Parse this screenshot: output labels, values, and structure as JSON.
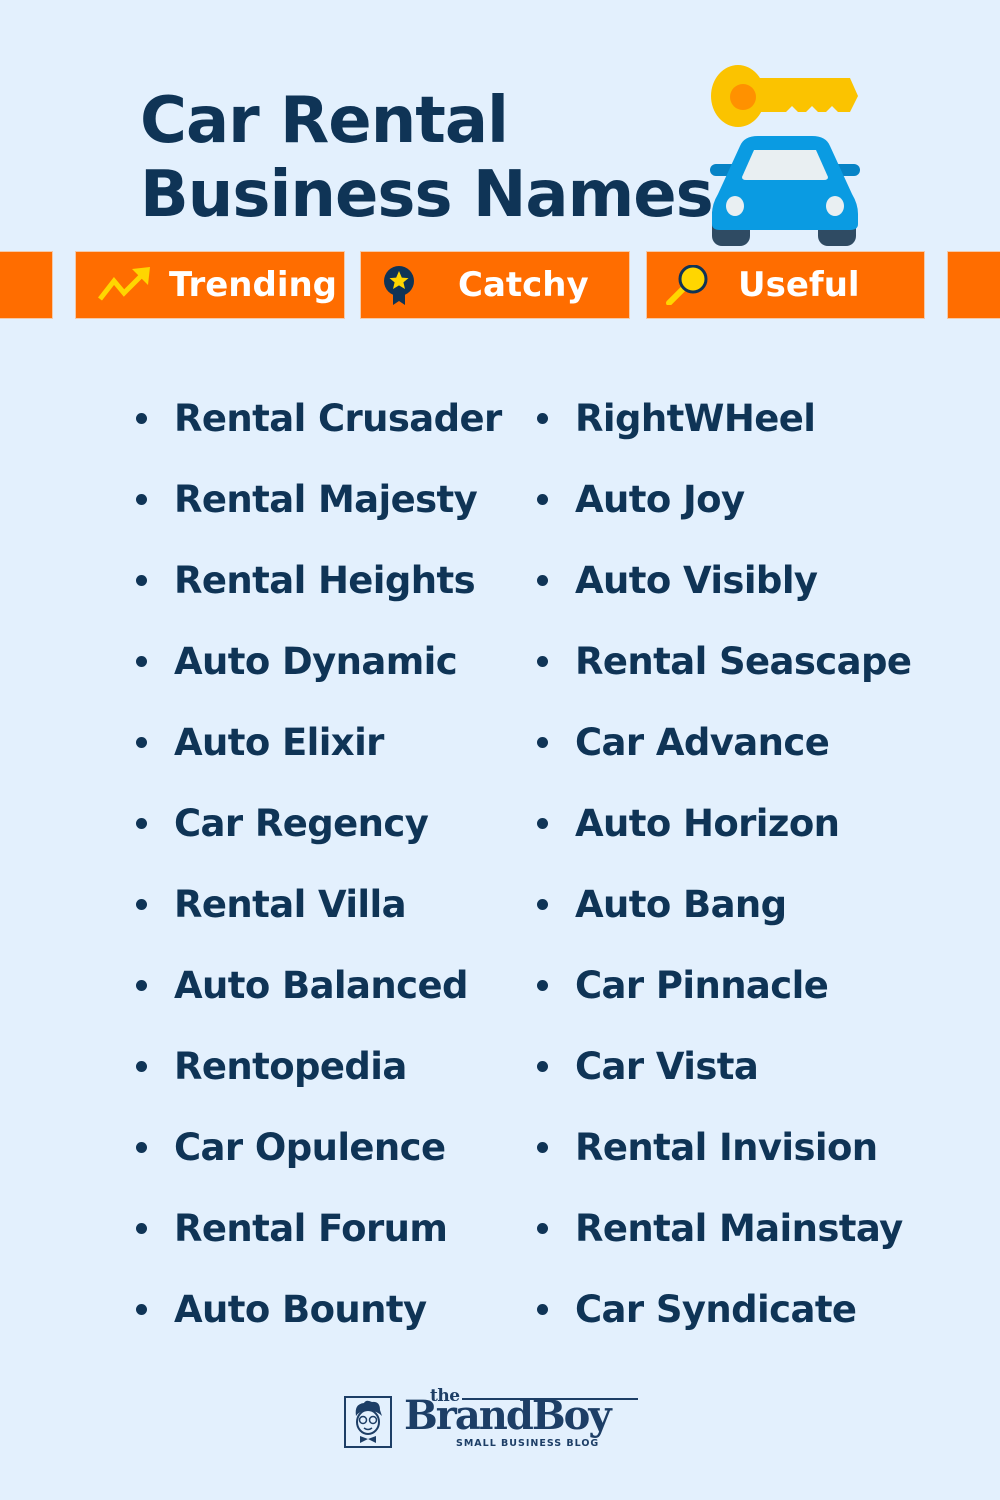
{
  "header": {
    "title_line1": "Car Rental",
    "title_line2": "Business Names",
    "hero_icons": [
      "key-icon",
      "car-icon"
    ]
  },
  "tags": [
    {
      "label": "Trending",
      "icon": "trending-up-icon"
    },
    {
      "label": "Catchy",
      "icon": "award-ribbon-star-icon"
    },
    {
      "label": "Useful",
      "icon": "magnifier-icon"
    }
  ],
  "names": {
    "left": [
      "Rental Crusader",
      "Rental Majesty",
      "Rental Heights",
      "Auto Dynamic",
      "Auto Elixir",
      "Car Regency",
      "Rental Villa",
      "Auto Balanced",
      "Rentopedia",
      "Car Opulence",
      "Rental Forum",
      "Auto Bounty"
    ],
    "right": [
      "RightWHeel",
      "Auto Joy",
      "Auto Visibly",
      "Rental Seascape",
      "Car Advance",
      "Auto Horizon",
      "Auto Bang",
      "Car Pinnacle",
      "Car Vista",
      "Rental Invision",
      "Rental Mainstay",
      "Car Syndicate"
    ]
  },
  "brand": {
    "the": "the",
    "name": "BrandBoy",
    "tagline": "SMALL BUSINESS BLOG",
    "icon": "brand-boy-avatar-icon"
  },
  "colors": {
    "background": "#e3f0fd",
    "text": "#0f3456",
    "accent_orange": "#ff6d00",
    "icon_yellow": "#fbc300",
    "car_blue": "#0a9be2"
  }
}
